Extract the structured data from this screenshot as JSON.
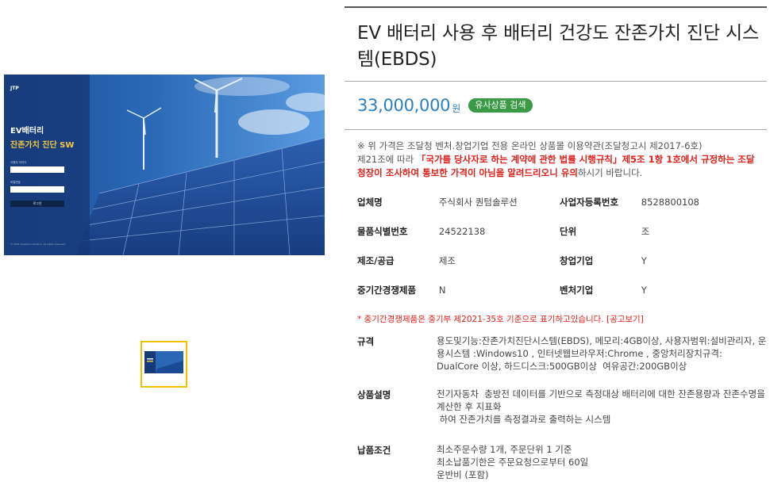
{
  "product_image": {
    "logo_text": "JTP",
    "headline1": "EV배터리",
    "headline2": "잔존가치 진단 SW",
    "field1_label": "사용자 아이디",
    "field2_label": "비밀번호",
    "login_label": "로그인",
    "footer": "© 2021 Quantum Solution, All rights reserved."
  },
  "title": "EV 배터리 사용 후 배터리 건강도 잔존가치 진단 시스템(EBDS)",
  "price": {
    "amount": "33,000,000",
    "unit": "원",
    "similar_label": "유사상품 검색"
  },
  "notice": {
    "line1": "※ 위 가격은 조달청 벤처.창업기업 전용 온라인 상품몰 이용약관(조달청고시 제2017-6호)",
    "line2_prefix": "제21조에 따라 ",
    "line2_red": "「국가를 당사자로 하는 계약에 관한 법률 시행규칙」제5조 1항 1호에서 규정하는 조달청장이 조사하여 통보한 가격이 아님을 알려드리오니 유의",
    "line2_suffix": "하시기 바랍니다."
  },
  "info": {
    "company_label": "업체명",
    "company": "주식회사 퀀텀솔루션",
    "bizno_label": "사업자등록번호",
    "bizno": "8528800108",
    "itemno_label": "물품식별번호",
    "itemno": "24522138",
    "unit_label": "단위",
    "unit": "조",
    "supply_label": "제조/공급",
    "supply": "제조",
    "startup_label": "창업기업",
    "startup": "Y",
    "sme_label": "중기간경쟁제품",
    "sme": "N",
    "venture_label": "벤처기업",
    "venture": "Y"
  },
  "sme_note": {
    "text": "* 중기간경쟁제품은 중기부 제2021-35호 기준으로 표기하고있습니다. ",
    "link": "[공고보기]"
  },
  "spec": {
    "label": "규격",
    "value": "용도및기능:잔존가치진단시스템(EBDS), 메모리:4GB이상, 사용자범위:설비관리자, 운용시스템 :Windows10 , 인터넷웹브라우저:Chrome , 중앙처리장치규격: DualCore 이상, 하드디스크:500GB이상  여유공간:200GB이상"
  },
  "desc": {
    "label": "상품설명",
    "value": "전기자동차  충방전 데이터를 기반으로 측정대상 배터리에 대한 잔존용량과 잔존수명을 계산한 후 지표화\n 하여 잔존가치를 측정결과로 출력하는 시스템"
  },
  "delivery": {
    "label": "납품조건",
    "value": "최소주문수량 1개, 주문단위 1 기준\n최소납품기한은 주문요청으로부터 60일\n운반비 (포함)"
  },
  "colors": {
    "price": "#2a7fc1",
    "similar_btn": "#3b9a45",
    "alert": "#e0201b",
    "thumb_border": "#f2c200"
  }
}
